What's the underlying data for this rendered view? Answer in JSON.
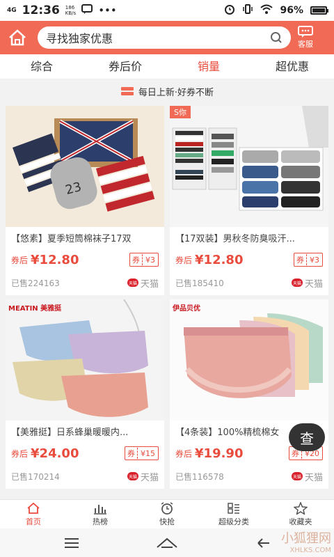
{
  "status": {
    "net": "4G",
    "time": "12:36",
    "speed_val": "186",
    "speed_unit": "KB/s",
    "battery": "96%"
  },
  "header": {
    "search_placeholder": "寻找独家优惠",
    "service_label": "客服"
  },
  "tabs": [
    {
      "label": "综合"
    },
    {
      "label": "券后价"
    },
    {
      "label": "销量"
    },
    {
      "label": "超优惠"
    }
  ],
  "notice": "每日上新·好券不断",
  "products": [
    {
      "title": "【悠素】夏季短筒棉袜子17双",
      "price_prefix": "券后",
      "price": "¥12.80",
      "coupon_label": "券",
      "coupon_value": "¥3",
      "sold": "已售224163",
      "store": "天猫",
      "tmall_logo": "天猫"
    },
    {
      "badge": "S你",
      "title": "【17双装】男秋冬防臭吸汗...",
      "price_prefix": "券后",
      "price": "¥12.80",
      "coupon_label": "券",
      "coupon_value": "¥3",
      "sold": "已售185410",
      "store": "天猫",
      "tmall_logo": "天猫"
    },
    {
      "brand": "MEATIN 美雅挺",
      "title": "【美雅挺】日系蜂巢暖暖内...",
      "price_prefix": "券后",
      "price": "¥24.00",
      "coupon_label": "券",
      "coupon_value": "¥15",
      "sold": "已售170214",
      "store": "天猫",
      "tmall_logo": "天猫"
    },
    {
      "brand": "伊品贝优",
      "title": "【4条装】100%精梳棉女",
      "price_prefix": "券后",
      "price": "¥19.90",
      "coupon_label": "券",
      "coupon_value": "¥20",
      "sold": "已售116578",
      "store": "天猫",
      "tmall_logo": "天猫"
    }
  ],
  "fab_label": "查",
  "bottom_nav": [
    {
      "label": "首页"
    },
    {
      "label": "热榜"
    },
    {
      "label": "快抢"
    },
    {
      "label": "超级分类"
    },
    {
      "label": "收藏夹"
    }
  ],
  "watermark": {
    "main": "小狐狸网",
    "sub": "XHLKS.COM"
  },
  "colors": {
    "brand": "#f06a55",
    "accent": "#e94b3c"
  }
}
